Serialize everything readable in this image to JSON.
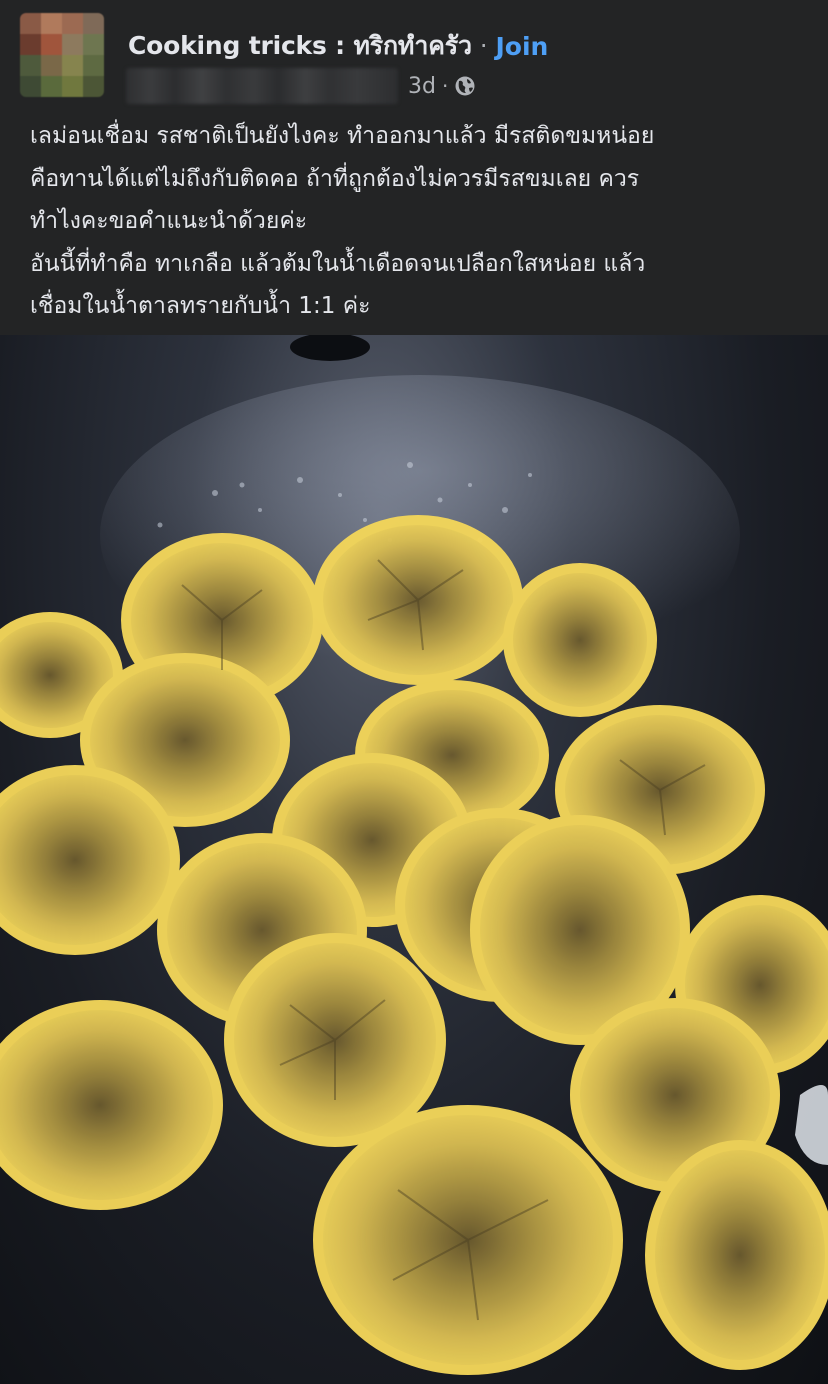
{
  "post": {
    "group_name": "Cooking tricks : ทริกทำครัว",
    "separator": "·",
    "join_label": "Join",
    "time_ago": "3d",
    "meta_separator": "·",
    "privacy_icon": "globe-icon",
    "text_lines": [
      "เลม่อนเชื่อม รสชาติเป็นยังไงคะ ทำออกมาแล้ว มีรสติดขมหน่อย",
      "คือทานได้แต่ไม่ถึงกับติดคอ ถ้าที่ถูกต้องไม่ควรมีรสขมเลย ควร",
      "ทำไงคะขอคำแนะนำด้วยค่ะ",
      "อันนี้ที่ทำคือ ทาเกลือ แล้วต้มในน้ำเดือดจนเปลือกใสหน่อย แล้ว",
      "เชื่อมในน้ำตาลทรายกับน้ำ 1:1 ค่ะ"
    ],
    "photo_icon": "candied-lemon-slices-photo"
  },
  "colors": {
    "background": "#232425",
    "text_primary": "#e4e6eb",
    "text_secondary": "#b0b3b8",
    "link": "#4e9ff5",
    "lemon_rind": "#e8c43a",
    "lemon_flesh": "#d8b84c",
    "pan_dark": "#14171d"
  }
}
